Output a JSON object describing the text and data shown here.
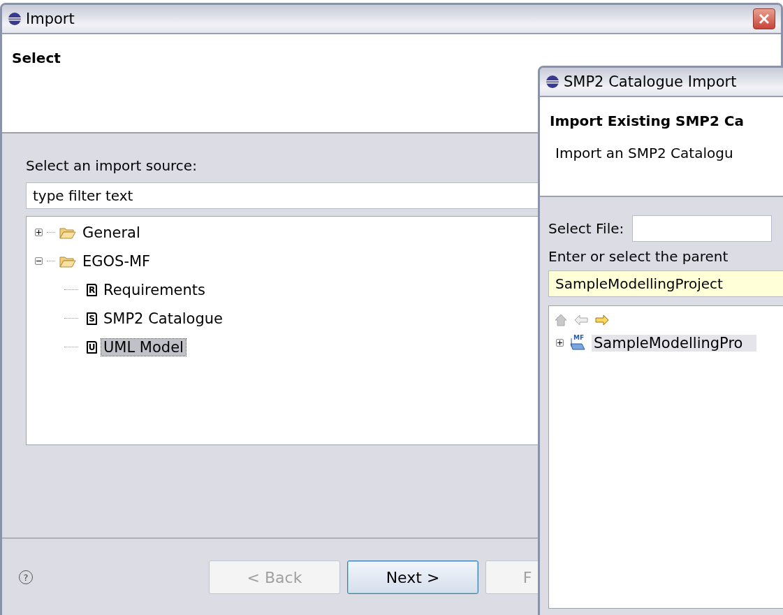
{
  "main_window": {
    "title": "Import",
    "header": {
      "title": "Select"
    },
    "source_label": "Select an import source:",
    "filter": {
      "placeholder": "type filter text"
    },
    "tree": [
      {
        "label": "General",
        "kind": "folder",
        "expanded": false,
        "selected": false
      },
      {
        "label": "EGOS-MF",
        "kind": "folder",
        "expanded": true,
        "selected": false,
        "children": [
          {
            "label": "Requirements",
            "kind": "document",
            "icon_letter": "R",
            "selected": false
          },
          {
            "label": "SMP2 Catalogue",
            "kind": "document",
            "icon_letter": "S",
            "selected": false
          },
          {
            "label": "UML Model",
            "kind": "document",
            "icon_letter": "U",
            "selected": true
          }
        ]
      }
    ],
    "help": "?",
    "buttons": [
      {
        "label": "< Back",
        "disabled": true,
        "default": false
      },
      {
        "label": "Next >",
        "disabled": false,
        "default": true
      },
      {
        "label": "F",
        "disabled": true,
        "default": false
      }
    ]
  },
  "dialog": {
    "title": "SMP2 Catalogue Import",
    "header": {
      "title": "Import Existing SMP2 Ca",
      "description": "Import an SMP2 Catalogu"
    },
    "file_label": "Select File:",
    "parent_label": "Enter or select the parent",
    "parent_field": {
      "value": "SampleModellingProject"
    },
    "nav": [
      {
        "kind": "home",
        "disabled": true
      },
      {
        "kind": "back",
        "disabled": true
      },
      {
        "kind": "forward",
        "disabled": false
      }
    ],
    "tree": [
      {
        "label": "SampleModellingPro",
        "badge": "MF",
        "expanded": false,
        "selected": true
      }
    ]
  }
}
